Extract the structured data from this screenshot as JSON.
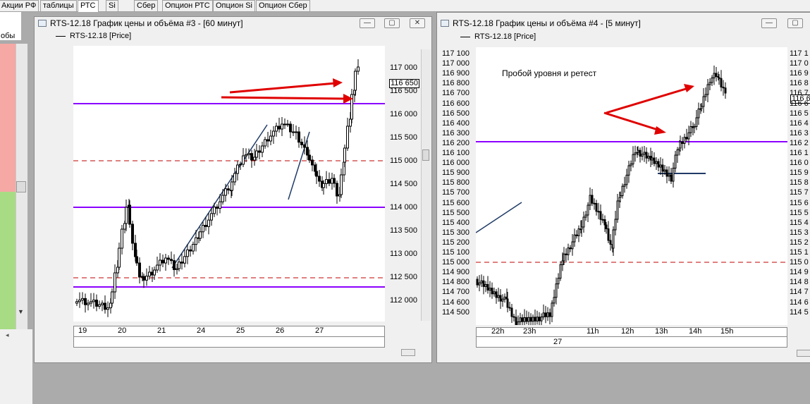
{
  "tabs": [
    "Акции РФ",
    "таблицы",
    "РТС",
    "Si",
    "Сбер",
    "Опцион РТС",
    "Опцион Si",
    "Опцион Сбер"
  ],
  "left_panel": {
    "fragment_text": "обы"
  },
  "chart1": {
    "title": "RTS-12.18 График цены и объёма #3 - [60 минут]",
    "legend": "RTS-12.18 [Price]",
    "current_price": "116 650",
    "buttons": {
      "minimize": "—",
      "restore": "▢",
      "close": "✕"
    },
    "y_ticks": [
      "117 000",
      "116 500",
      "116 000",
      "115 500",
      "115 000",
      "114 500",
      "114 000",
      "113 500",
      "113 000",
      "112 500",
      "112 000"
    ],
    "x_ticks": [
      "19",
      "20",
      "21",
      "24",
      "25",
      "26",
      "27"
    ]
  },
  "chart2": {
    "title": "RTS-12.18 График цены и объёма #4 - [5 минут]",
    "legend": "RTS-12.18 [Price]",
    "annotation": "Пробой уровня и ретест",
    "current_price": "116 6",
    "buttons": {
      "minimize": "—",
      "restore": "▢",
      "close": "✕"
    },
    "y_ticks_left": [
      "117 100",
      "117 000",
      "116 900",
      "116 800",
      "116 700",
      "116 600",
      "116 500",
      "116 400",
      "116 300",
      "116 200",
      "116 100",
      "116 000",
      "115 900",
      "115 800",
      "115 700",
      "115 600",
      "115 500",
      "115 400",
      "115 300",
      "115 200",
      "115 100",
      "115 000",
      "114 900",
      "114 800",
      "114 700",
      "114 600",
      "114 500"
    ],
    "y_ticks_right": [
      "117 1",
      "117 0",
      "116 9",
      "116 8",
      "116 7",
      "116 6",
      "116 5",
      "116 4",
      "116 3",
      "116 2",
      "116 1",
      "116 0",
      "115 9",
      "115 8",
      "115 7",
      "115 6",
      "115 5",
      "115 4",
      "115 3",
      "115 2",
      "115 1",
      "115 0",
      "114 9",
      "114 8",
      "114 7",
      "114 6",
      "114 5"
    ],
    "x_ticks": [
      "22h",
      "23h",
      "11h",
      "12h",
      "13h",
      "14h",
      "15h"
    ],
    "x_date": "27"
  },
  "colors": {
    "level_line": "#8b00ff",
    "dashed_level": "#c00000",
    "trend_line": "#1f3a66",
    "arrow": "#e00000",
    "candle": "#000000"
  }
}
